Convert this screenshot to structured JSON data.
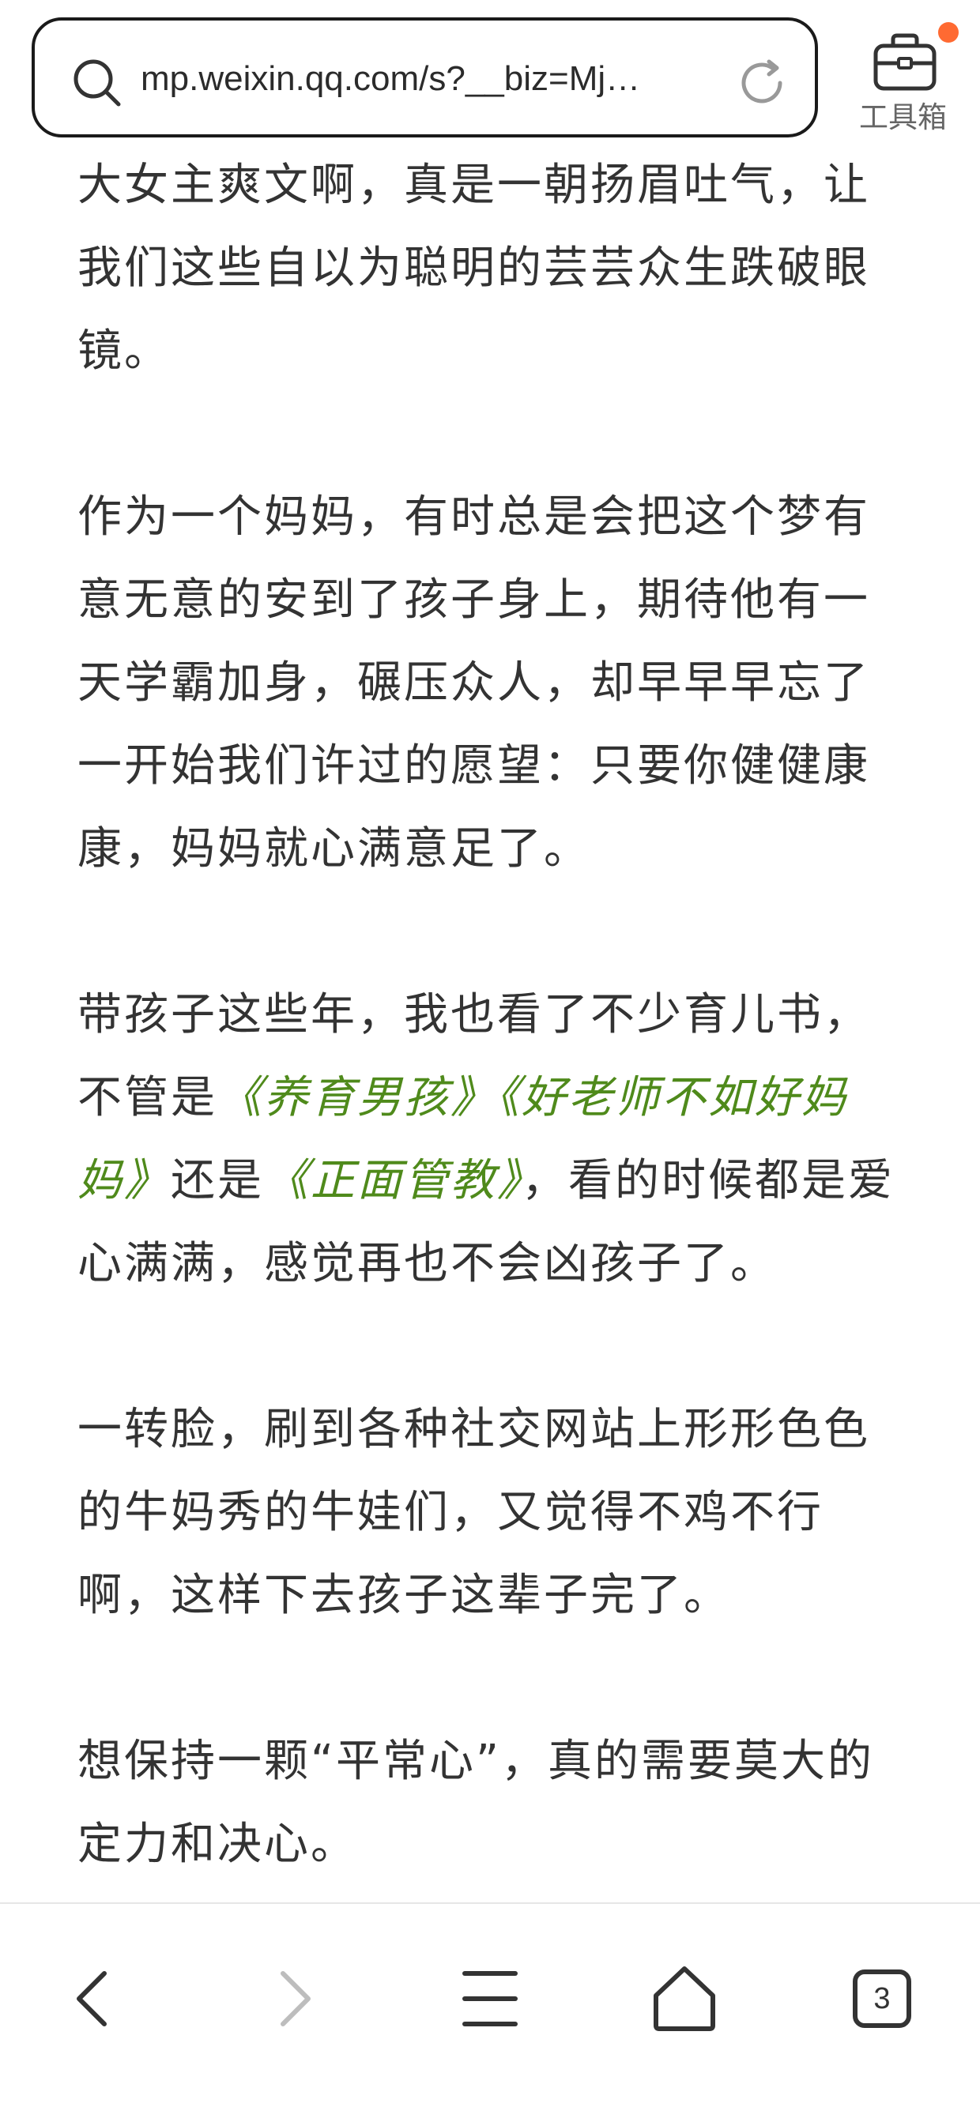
{
  "browser": {
    "url": "mp.weixin.qq.com/s?__biz=Mj…",
    "toolbox_label": "工具箱",
    "tab_count": "3"
  },
  "colors": {
    "link_green": "#4f8a1b",
    "notification_dot": "#ff6a32",
    "text": "#333333"
  },
  "article": {
    "p1": "大女主爽文啊，真是一朝扬眉吐气，让我们这些自以为聪明的芸芸众生跌破眼镜。",
    "p2": "作为一个妈妈，有时总是会把这个梦有意无意的安到了孩子身上，期待他有一天学霸加身，碾压众人，却早早早忘了一开始我们许过的愿望：只要你健健康康，妈妈就心满意足了。",
    "p3_a": "带孩子这些年，我也看了不少育儿书，不管是",
    "p3_book1": "《养育男孩》",
    "p3_book2": "《好老师不如好妈妈》",
    "p3_b": "还是",
    "p3_book3": "《正面管教》",
    "p3_c": "，看的时候都是爱心满满，感觉再也不会凶孩子了。",
    "p4": "一转脸，刷到各种社交网站上形形色色的牛妈秀的牛娃们，又觉得不鸡不行啊，这样下去孩子这辈子完了。",
    "p5": "想保持一颗“平常心”，真的需要莫大的定力和决心。"
  },
  "nav": {
    "icons": [
      "back-icon",
      "forward-icon",
      "menu-icon",
      "home-icon",
      "tabs-icon"
    ]
  }
}
